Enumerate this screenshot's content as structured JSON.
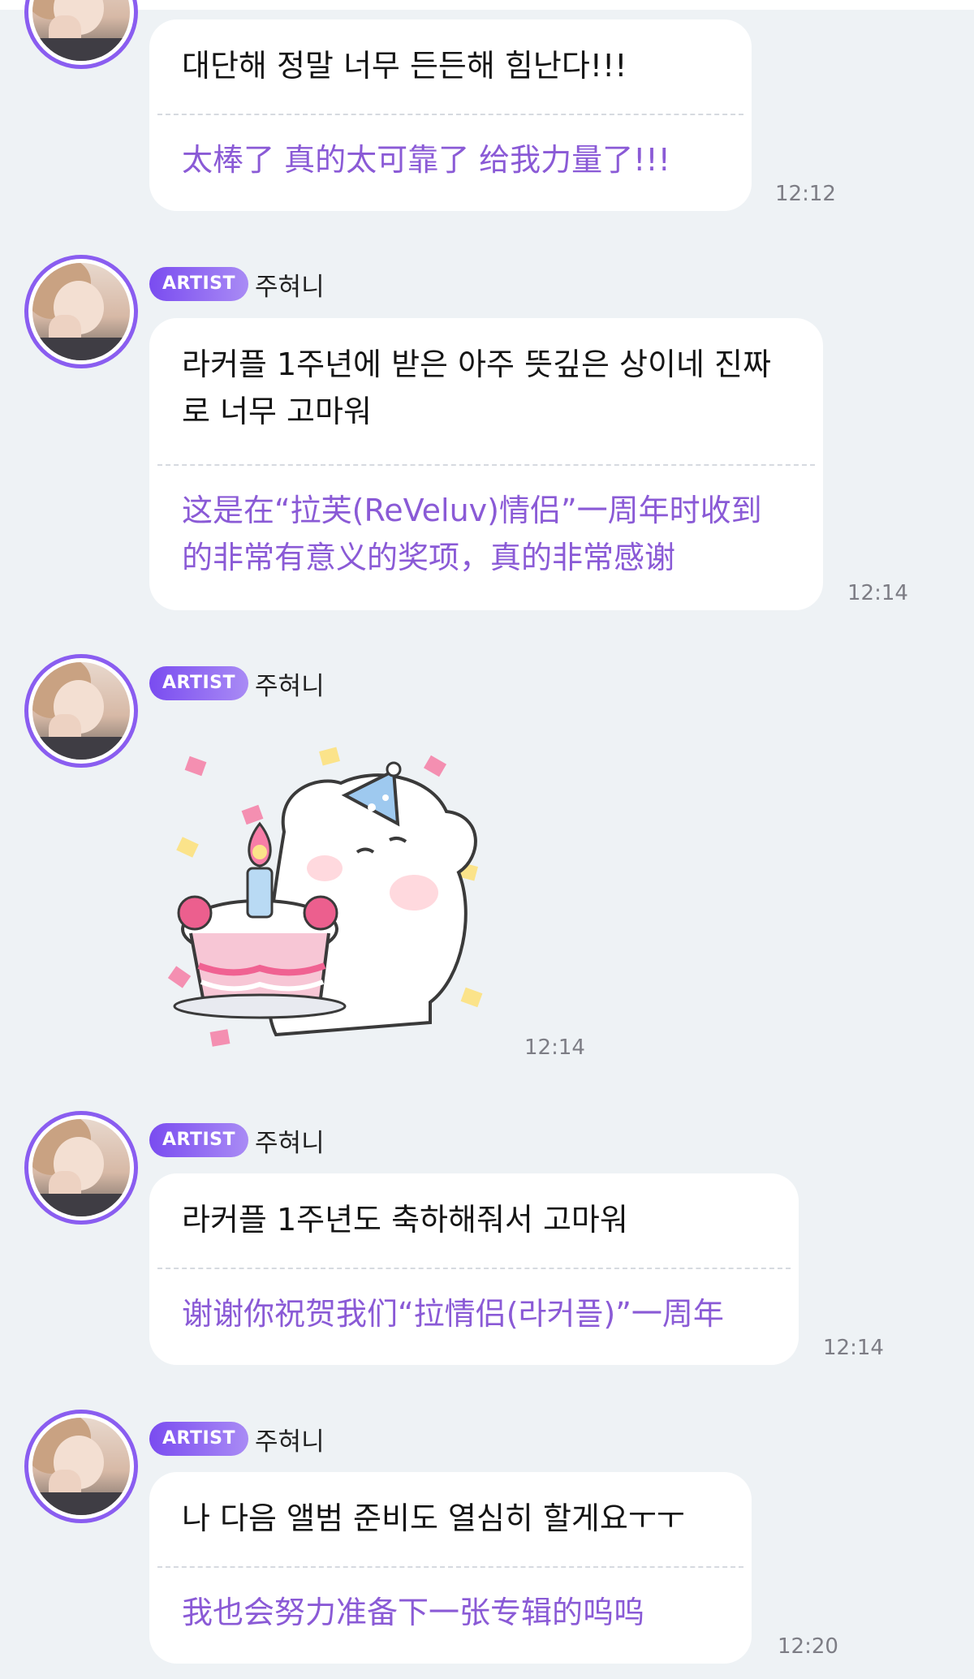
{
  "messages": [
    {
      "original": "대단해 정말 너무 든든해 힘난다!!!",
      "translation": "太棒了 真的太可靠了 给我力量了!!!",
      "time": "12:12"
    },
    {
      "badge": "ARTIST",
      "sender": "주혀니",
      "original": "라커플 1주년에 받은 아주 뜻깊은 상이네 진짜로 너무 고마워",
      "translation": "这是在“拉芙(ReVeluv)情侣”一周年时收到的非常有意义的奖项，真的非常感谢",
      "time": "12:14"
    },
    {
      "badge": "ARTIST",
      "sender": "주혀니",
      "sticker": "birthday-cake-bear-sticker",
      "time": "12:14"
    },
    {
      "badge": "ARTIST",
      "sender": "주혀니",
      "original": "라커플 1주년도 축하해줘서 고마워",
      "translation": "谢谢你祝贺我们“拉情侣(라커플)”一周年",
      "time": "12:14"
    },
    {
      "badge": "ARTIST",
      "sender": "주혀니",
      "original": "나 다음 앨범 준비도 열심히 할게요ㅜㅜ",
      "translation": "我也会努力准备下一张专辑的呜呜",
      "time": "12:20"
    }
  ],
  "colors": {
    "background": "#eef2f5",
    "badge": "#7a4cf0",
    "translation_text": "#8a5ad6",
    "avatar_ring": "#8a5df0"
  }
}
